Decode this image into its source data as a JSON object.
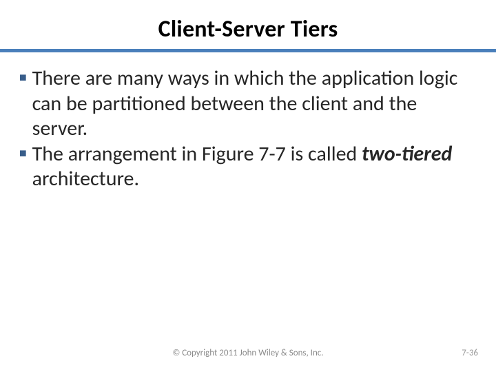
{
  "title": "Client-Server Tiers",
  "bullets": [
    {
      "text_pre": " There are many ways in which the application logic can be partitioned between the client and the server.",
      "emph": "",
      "text_post": ""
    },
    {
      "text_pre": "The arrangement in Figure 7-7 is called ",
      "emph": "two-tiered",
      "text_post": " architecture."
    }
  ],
  "footer": {
    "copyright": "© Copyright 2011 John Wiley & Sons, Inc.",
    "page": "7-36"
  }
}
